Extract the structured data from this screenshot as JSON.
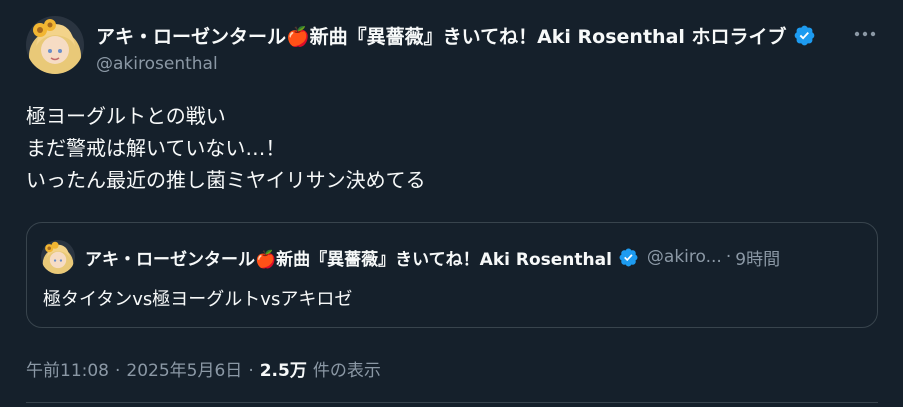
{
  "tweet": {
    "display_name": "アキ・ローゼンタール🍎新曲『異薔薇』きいてね！Aki Rosenthal ホロライブ",
    "handle": "@akirosenthal",
    "body_lines": [
      "極ヨーグルトとの戦い",
      "まだ警戒は解いていない…！",
      "いったん最近の推し菌ミヤイリサン決めてる"
    ]
  },
  "quote": {
    "display_name": "アキ・ローゼンタール🍎新曲『異薔薇』きいてね！Aki Rosenthal",
    "handle": "@akiro...",
    "dot": "·",
    "time": "9時間",
    "text": "極タイタンvs極ヨーグルトvsアキロゼ"
  },
  "meta": {
    "time": "午前11:08",
    "sep1": "·",
    "date": "2025年5月6日",
    "sep2": "·",
    "views_count": "2.5万",
    "views_label": "件の表示"
  },
  "colors": {
    "background": "#15202b",
    "text_primary": "#f7f9f9",
    "text_secondary": "#8b98a5",
    "border": "#38444d",
    "verified_blue": "#1d9bf0"
  },
  "icons": {
    "verified": "verified-badge-icon",
    "more": "more-horizontal-icon"
  }
}
